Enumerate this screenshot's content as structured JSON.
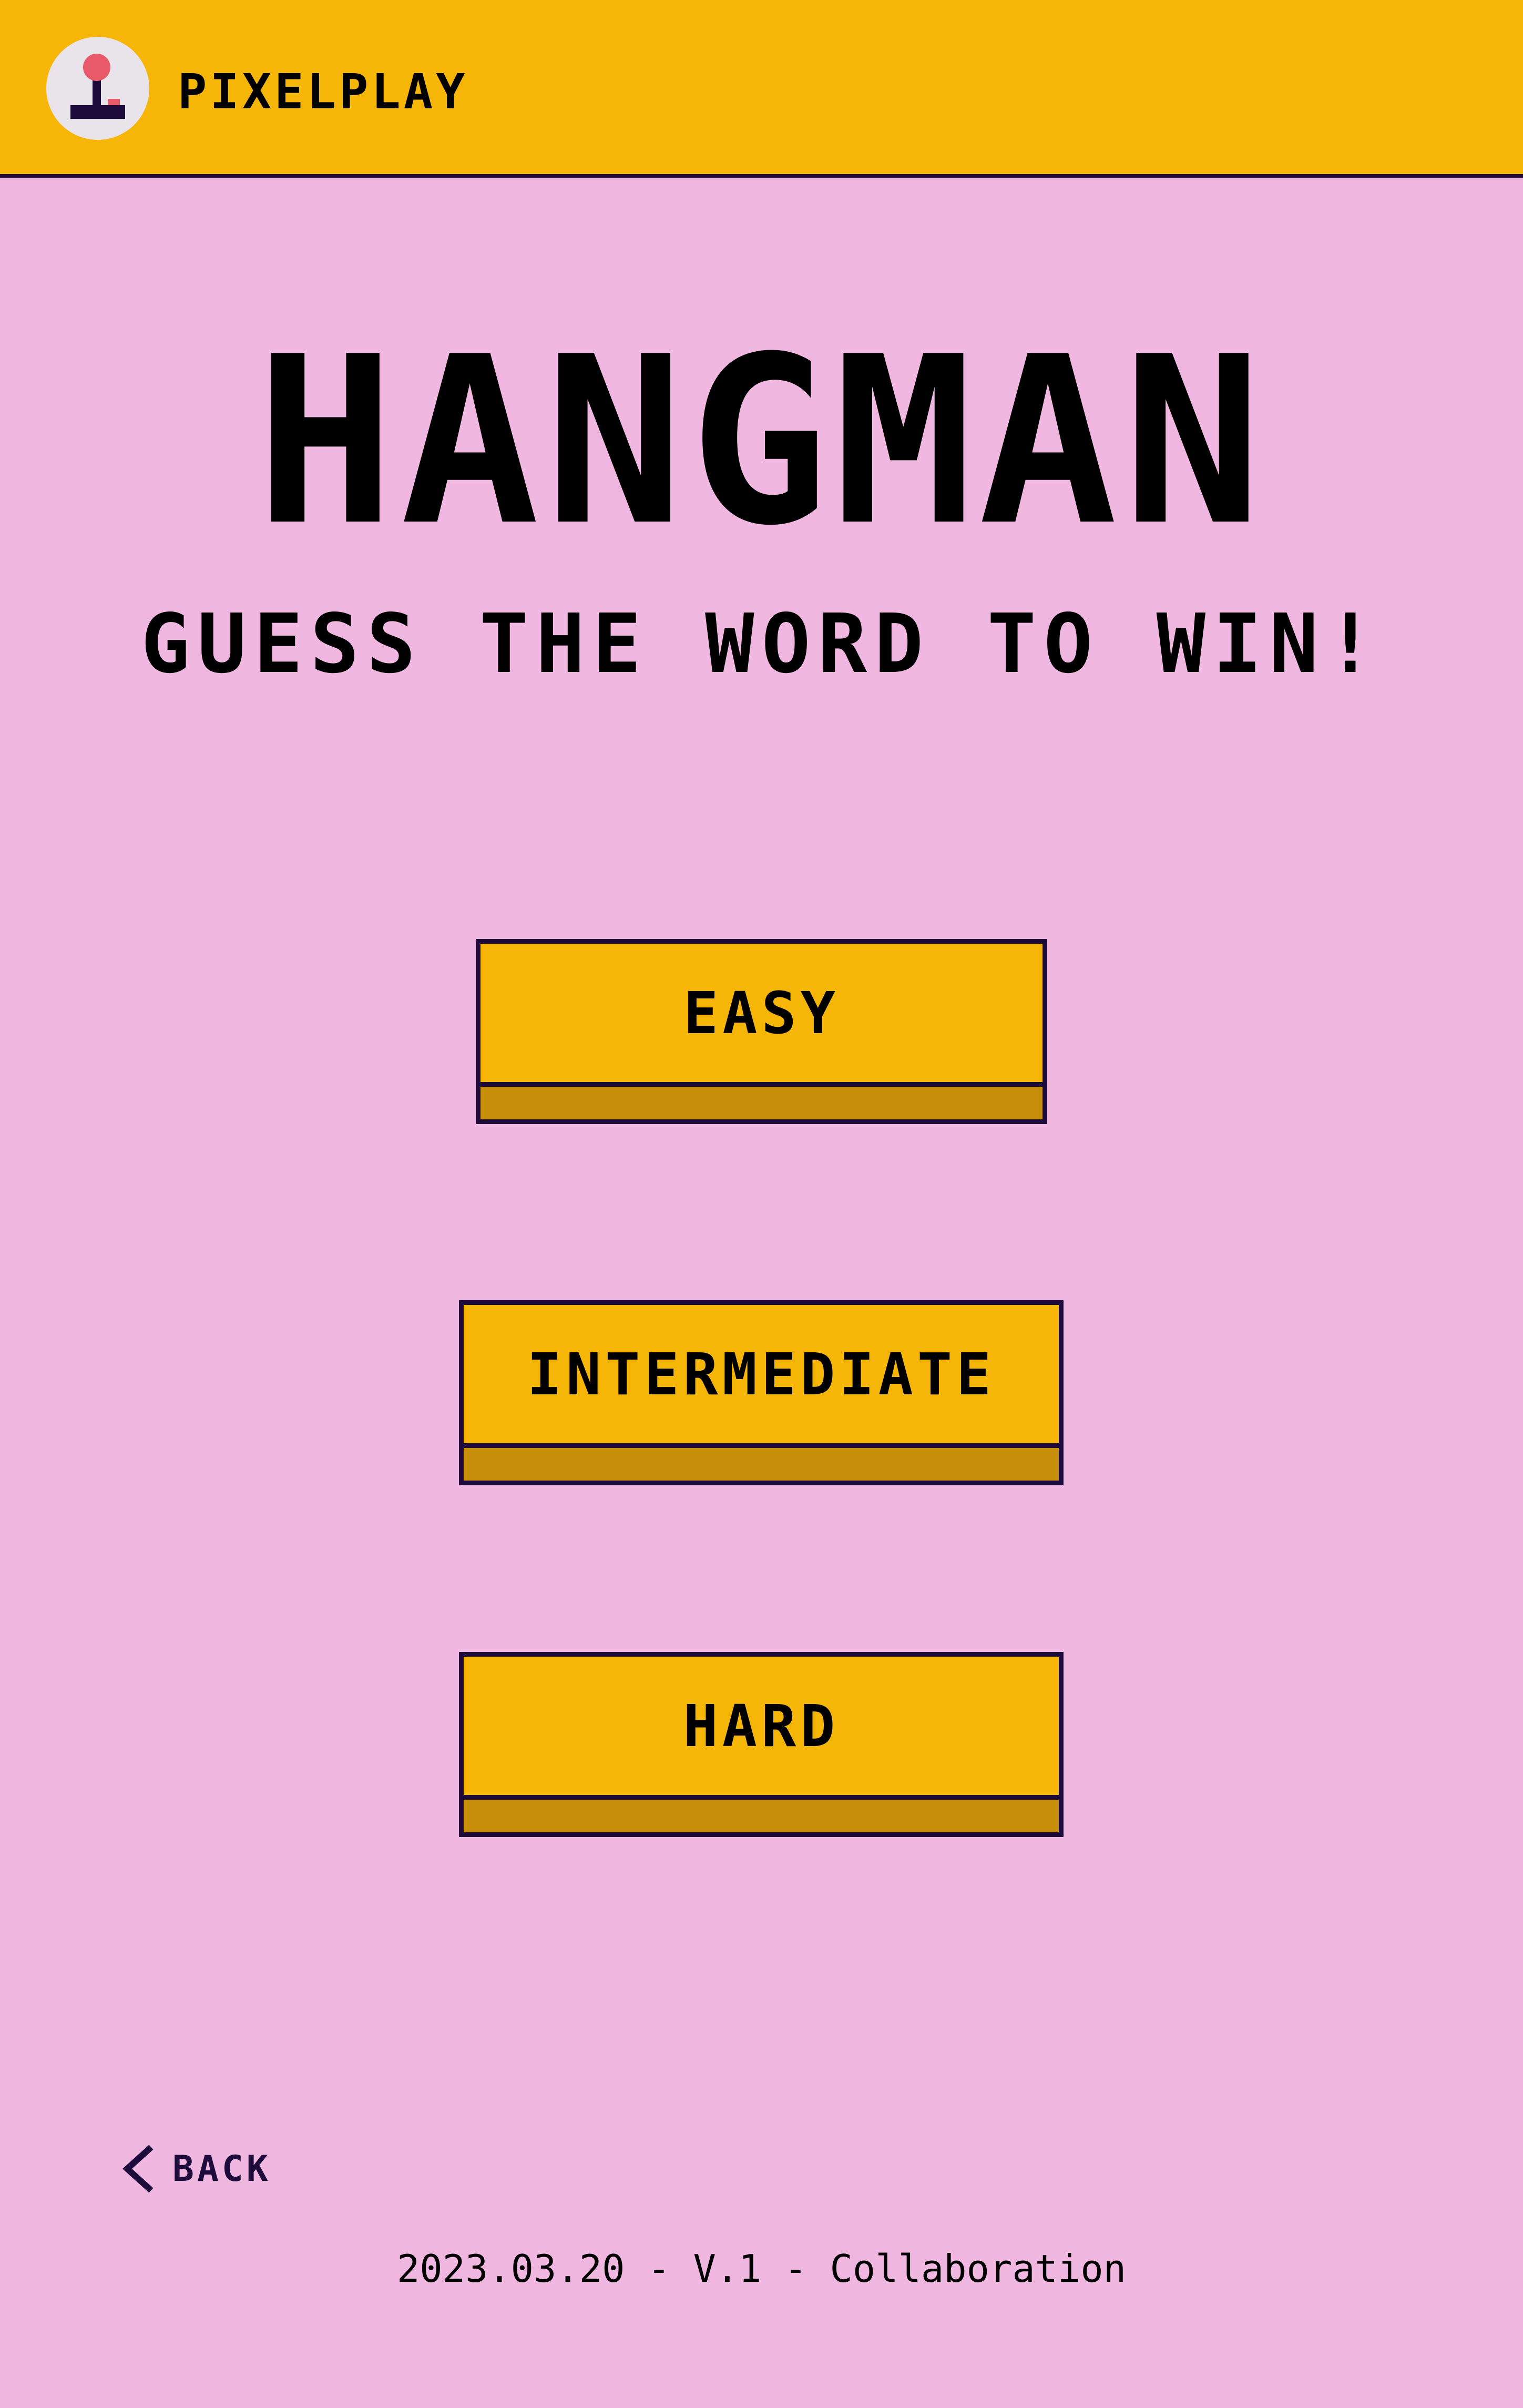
{
  "header": {
    "brand_name": "PIXELPLAY",
    "logo_icon": "joystick-icon"
  },
  "main": {
    "title": "HANGMAN",
    "subtitle": "GUESS THE WORD TO WIN!"
  },
  "levels": {
    "easy_label": "EASY",
    "intermediate_label": "INTERMEDIATE",
    "hard_label": "HARD"
  },
  "nav": {
    "back_label": "BACK",
    "back_icon": "chevron-left-icon"
  },
  "footer": {
    "text": "2023.03.20 - V.1 - Collaboration"
  },
  "colors": {
    "background": "#f0b8e0",
    "header": "#f5b607",
    "button_face": "#f5b607",
    "button_shadow": "#c8900a",
    "border": "#1e0d3c",
    "joystick_ball": "#e85a6a"
  }
}
